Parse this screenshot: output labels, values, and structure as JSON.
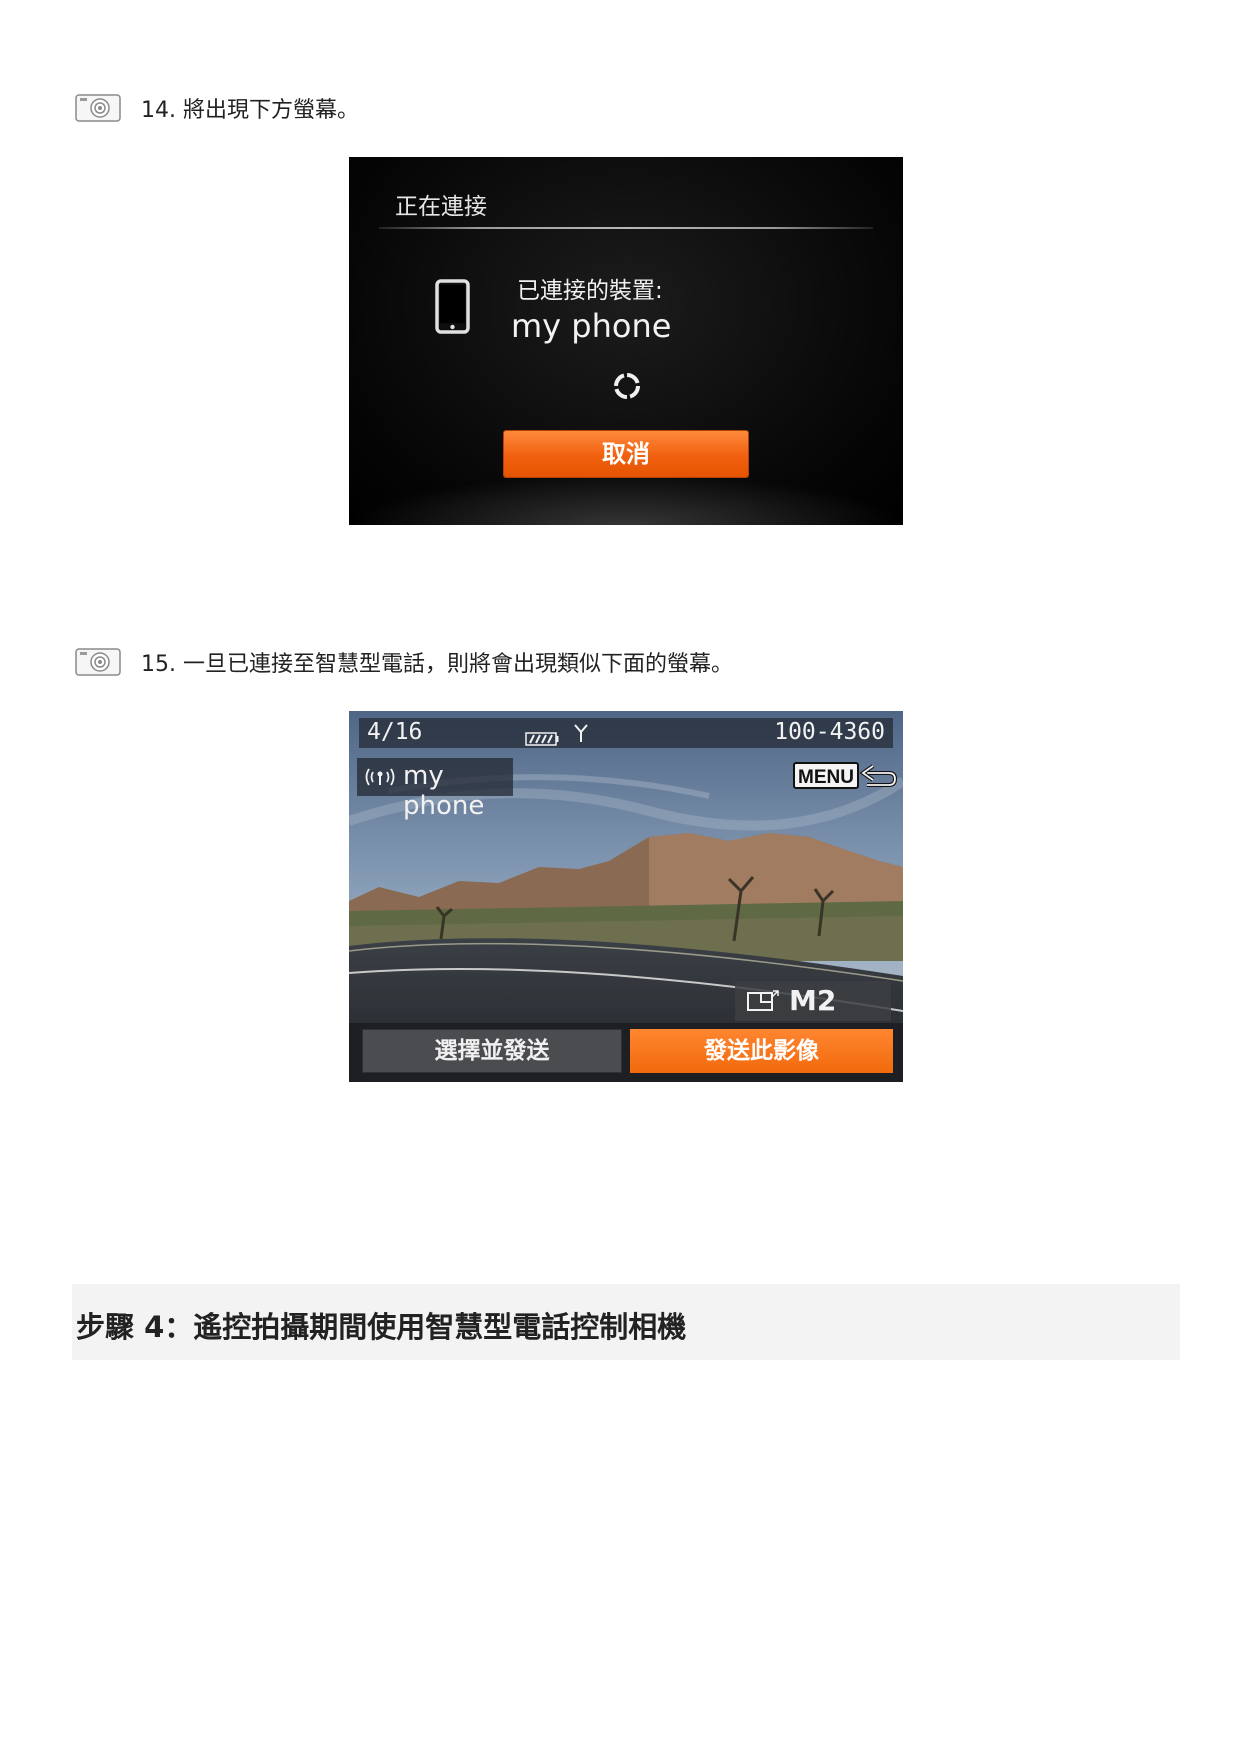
{
  "steps": [
    {
      "text": "14. 將出現下方螢幕。"
    },
    {
      "text": "15. 一旦已連接至智慧型電話，則將會出現類似下面的螢幕。"
    }
  ],
  "screen1": {
    "title": "正在連接",
    "connected_label": "已連接的裝置:",
    "device_name": "my phone",
    "cancel_label": "取消",
    "icons": [
      "smartphone-icon",
      "loading-spinner-icon"
    ]
  },
  "screen2": {
    "counter": "4/16",
    "file_number": "100-4360",
    "device_name": "my phone",
    "menu_label": "MENU",
    "size_label": "M2",
    "btn_select_send": "選擇並發送",
    "btn_send_image": "發送此影像",
    "icons": [
      "battery-icon",
      "antenna-icon",
      "wifi-icon",
      "menu-back-icon",
      "image-size-icon"
    ]
  },
  "section_heading": "步驟 4：遙控拍攝期間使用智慧型電話控制相機",
  "colors": {
    "accent_orange": "#f06010",
    "screen_bg": "#000000",
    "section_bg": "#f3f3f3"
  }
}
